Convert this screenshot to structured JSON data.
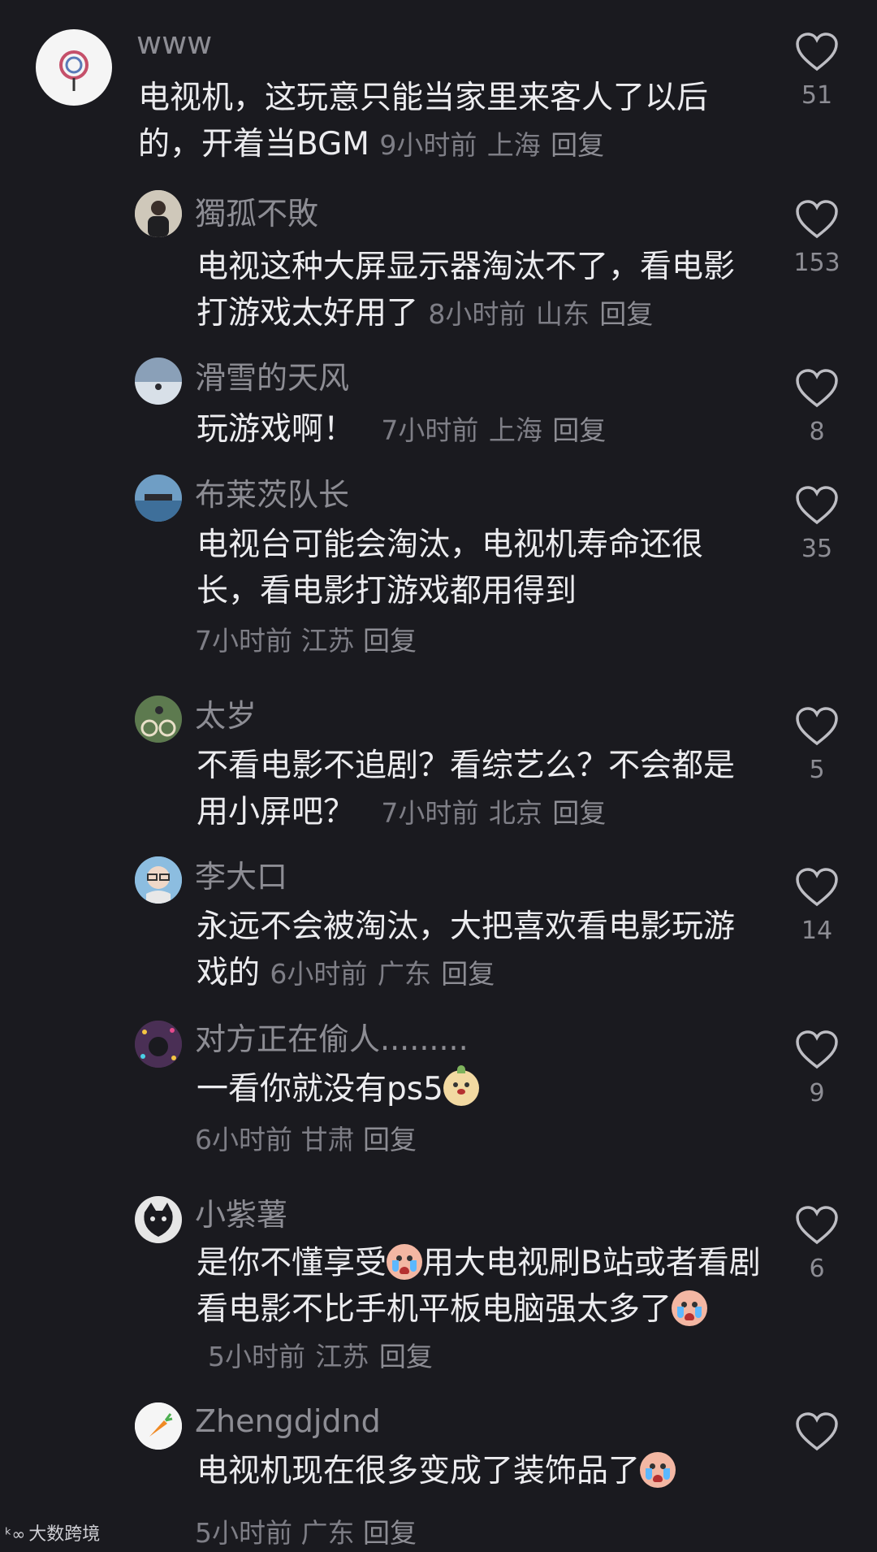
{
  "comments": [
    {
      "user": "www",
      "text": "电视机，这玩意只能当家里来客人了以后的，开着当BGM",
      "time": "9小时前",
      "location": "上海",
      "reply": "回复",
      "likes": "51"
    },
    {
      "user": "獨孤不敗",
      "text": "电视这种大屏显示器淘汰不了，看电影打游戏太好用了",
      "time": "8小时前",
      "location": "山东",
      "reply": "回复",
      "likes": "153"
    },
    {
      "user": "滑雪的天风",
      "text": "玩游戏啊！",
      "time": "7小时前",
      "location": "上海",
      "reply": "回复",
      "likes": "8"
    },
    {
      "user": "布莱茨队长",
      "text": "电视台可能会淘汰，电视机寿命还很长，看电影打游戏都用得到",
      "time": "7小时前",
      "location": "江苏",
      "reply": "回复",
      "likes": "35"
    },
    {
      "user": "太岁",
      "text": "不看电影不追剧？看综艺么？不会都是用小屏吧？",
      "time": "7小时前",
      "location": "北京",
      "reply": "回复",
      "likes": "5"
    },
    {
      "user": "李大口",
      "text": "永远不会被淘汰，大把喜欢看电影玩游戏的",
      "time": "6小时前",
      "location": "广东",
      "reply": "回复",
      "likes": "14"
    },
    {
      "user": "对方正在偷人.........",
      "text": "一看你就没有ps5",
      "time": "6小时前",
      "location": "甘肃",
      "reply": "回复",
      "likes": "9"
    },
    {
      "user": "小紫薯",
      "text_a": "是你不懂享受",
      "text_b": "用大电视刷B站或者看剧看电影不比手机平板电脑强太多了",
      "time": "5小时前",
      "location": "江苏",
      "reply": "回复",
      "likes": "6"
    },
    {
      "user": "Zhengdjdnd",
      "text": "电视机现在很多变成了装饰品了",
      "time": "5小时前",
      "location": "广东",
      "reply": "回复",
      "likes": ""
    }
  ],
  "watermark": {
    "logo": "ᵏ∞",
    "text": "大数跨境"
  }
}
